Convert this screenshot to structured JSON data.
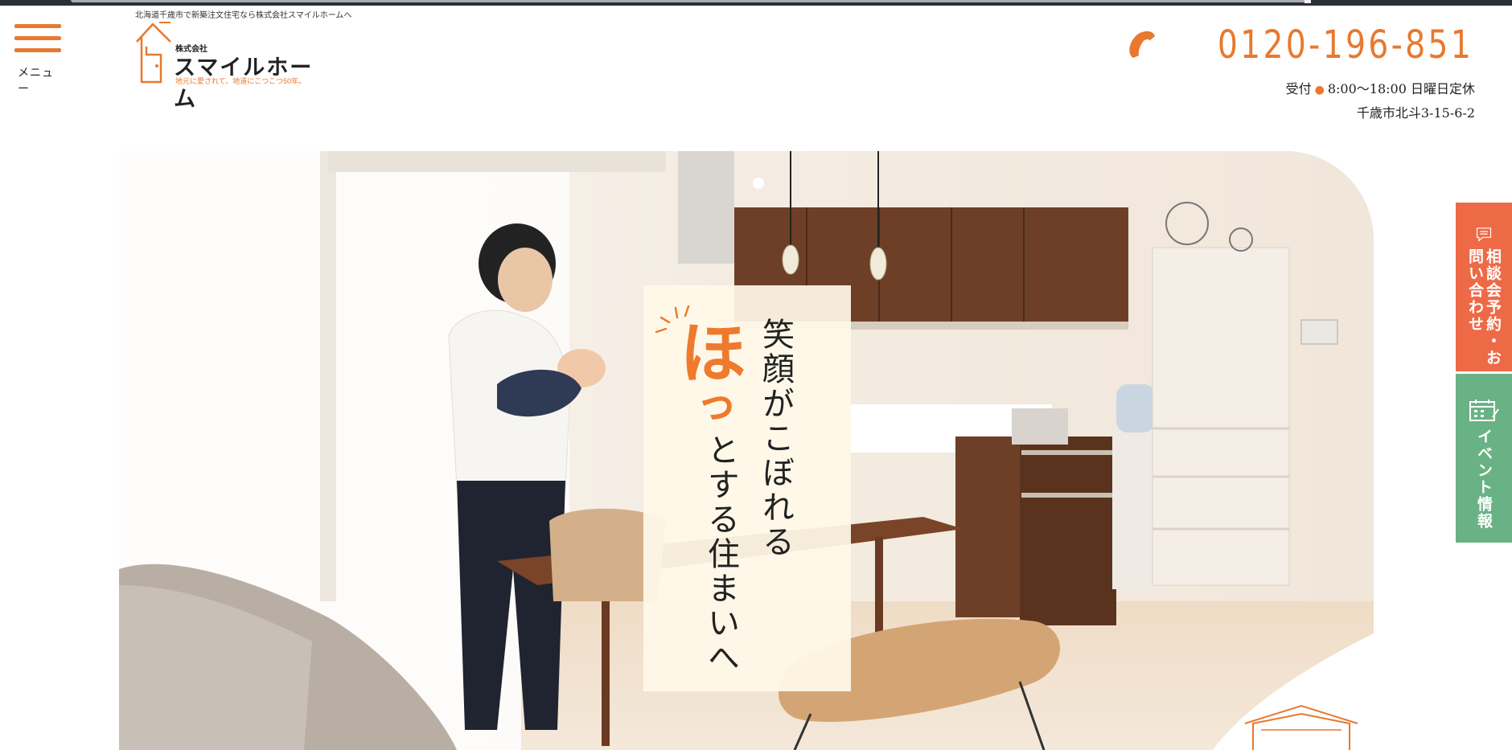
{
  "header": {
    "menu_label": "メニュー",
    "tagline": "北海道千歳市で新築注文住宅なら株式会社スマイルホームへ",
    "logo": {
      "company_type": "株式会社",
      "company_name": "スマイルホーム",
      "slogan": "地元に愛されて、地道にこつこつ50年。"
    },
    "phone": "0120-196-851",
    "hours_label": "受付",
    "hours_value": "8:00〜18:00 日曜日定休",
    "address": "千歳市北斗3-15-6-2"
  },
  "hero": {
    "catch_accent": "ほ",
    "catch_accent_small": "っ",
    "catch_line1": "笑顔がこぼれる",
    "catch_line2": "とする住まいへ"
  },
  "side_tabs": {
    "consult_label": "相談会予約・お問い合わせ",
    "event_label": "イベント情報"
  },
  "colors": {
    "accent_orange": "#e8792e",
    "consult_tab": "#ee6a47",
    "event_tab": "#69b285"
  },
  "icons": {
    "menu": "hamburger-icon",
    "logo": "house-icon",
    "phone": "phone-icon",
    "consult": "chat-bubble-icon",
    "event": "calendar-icon"
  }
}
